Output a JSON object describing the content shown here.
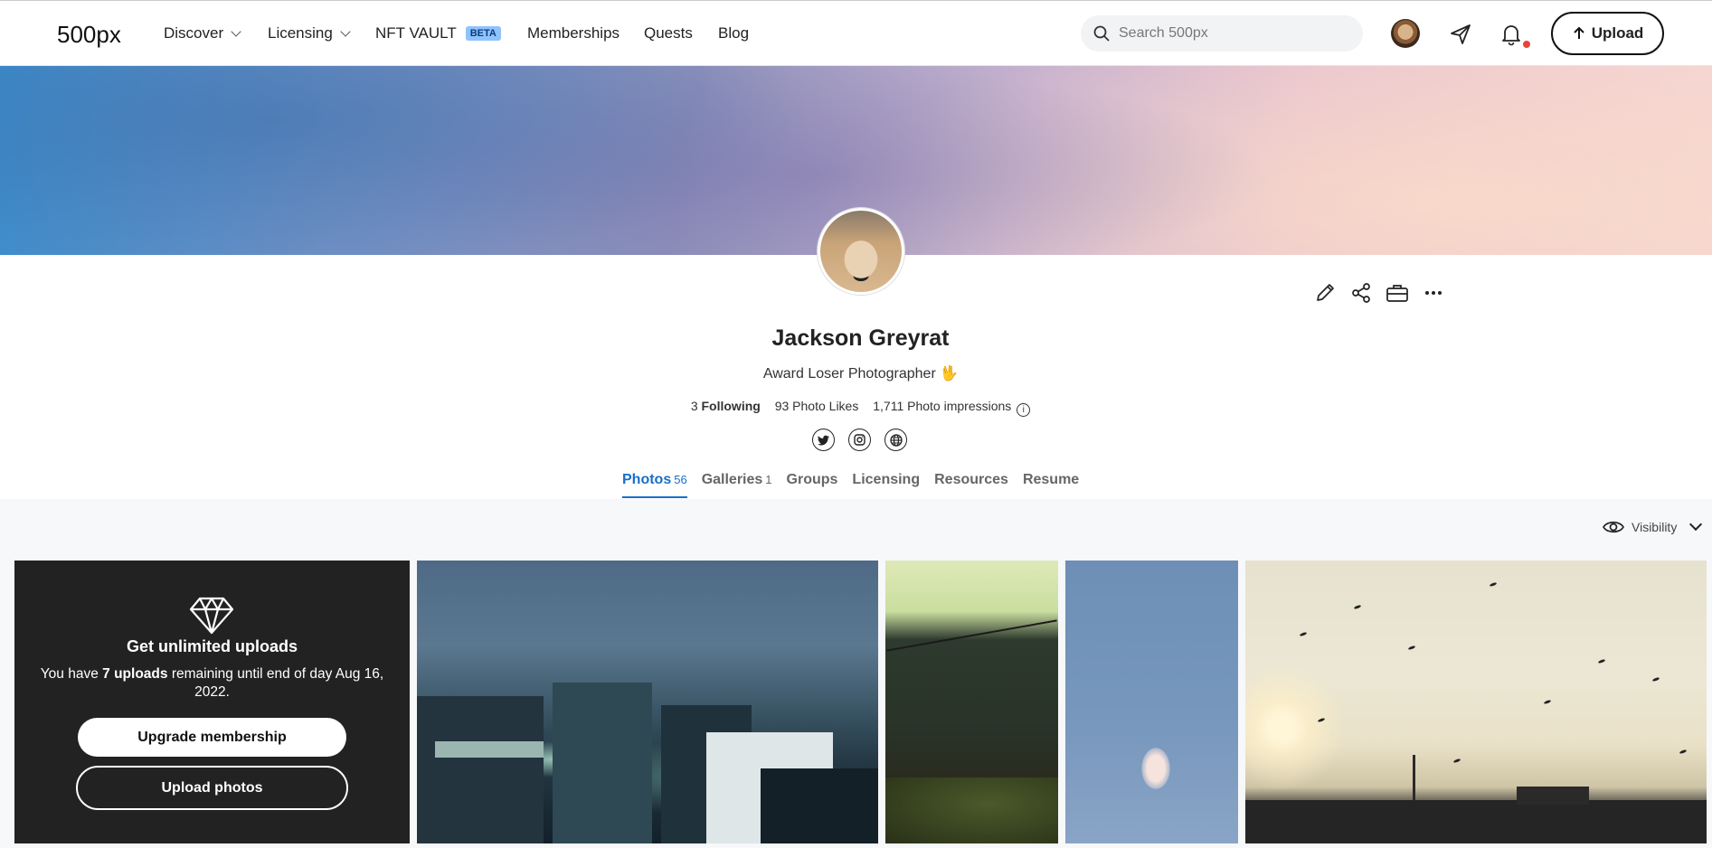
{
  "nav": {
    "logo": "500px",
    "items": [
      {
        "label": "Discover",
        "dropdown": true
      },
      {
        "label": "Licensing",
        "dropdown": true
      },
      {
        "label": "NFT VAULT",
        "badge": "BETA"
      },
      {
        "label": "Memberships"
      },
      {
        "label": "Quests"
      },
      {
        "label": "Blog"
      }
    ],
    "search_placeholder": "Search 500px",
    "upload_label": "Upload",
    "notification_dot_color": "#e6453a"
  },
  "profile": {
    "name": "Jackson Greyrat",
    "tagline": "Award Loser Photographer 🖖",
    "stats": {
      "following_count": "3",
      "following_label": "Following",
      "likes": "93 Photo Likes",
      "impressions": "1,711 Photo impressions"
    },
    "socials": [
      "twitter-icon",
      "instagram-icon",
      "website-icon"
    ],
    "actions": [
      "edit-icon",
      "share-icon",
      "portfolio-icon",
      "more-icon"
    ]
  },
  "tabs": [
    {
      "label": "Photos",
      "count": "56",
      "active": true
    },
    {
      "label": "Galleries",
      "count": "1"
    },
    {
      "label": "Groups",
      "count": ""
    },
    {
      "label": "Licensing",
      "count": ""
    },
    {
      "label": "Resources",
      "count": ""
    },
    {
      "label": "Resume",
      "count": ""
    }
  ],
  "visibility_label": "Visibility",
  "promo": {
    "title": "Get unlimited uploads",
    "text_prefix": "You have ",
    "uploads_bold": "7 uploads",
    "text_suffix": " remaining until end of day Aug 16, 2022.",
    "upgrade_label": "Upgrade membership",
    "upload_label": "Upload photos"
  },
  "colors": {
    "accent": "#1a6fc8",
    "promo_bg": "#222222"
  }
}
